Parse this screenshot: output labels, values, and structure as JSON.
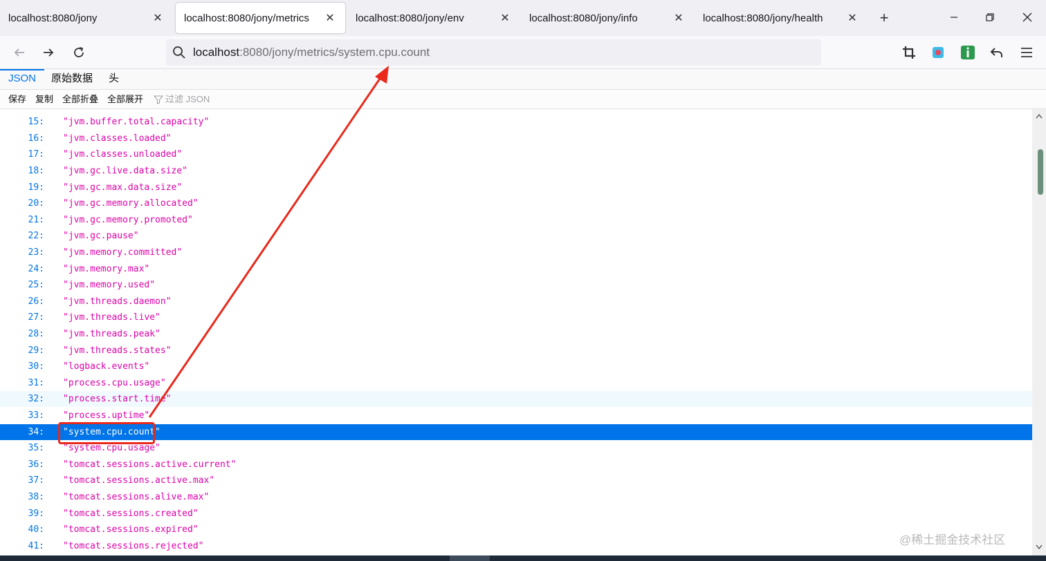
{
  "tabs": [
    {
      "title": "localhost:8080/jony",
      "active": false
    },
    {
      "title": "localhost:8080/jony/metrics",
      "active": true
    },
    {
      "title": "localhost:8080/jony/env",
      "active": false
    },
    {
      "title": "localhost:8080/jony/info",
      "active": false
    },
    {
      "title": "localhost:8080/jony/health",
      "active": false
    }
  ],
  "url": {
    "host": "localhost",
    "rest": ":8080/jony/metrics/system.cpu.count"
  },
  "viewer_tabs": [
    "JSON",
    "原始数据",
    "头"
  ],
  "toolbar": {
    "save": "保存",
    "copy": "复制",
    "collapse_all": "全部折叠",
    "expand_all": "全部展开",
    "filter_placeholder": "过滤 JSON"
  },
  "rows": [
    {
      "line": "15:",
      "value": "\"jvm.buffer.total.capacity\""
    },
    {
      "line": "16:",
      "value": "\"jvm.classes.loaded\""
    },
    {
      "line": "17:",
      "value": "\"jvm.classes.unloaded\""
    },
    {
      "line": "18:",
      "value": "\"jvm.gc.live.data.size\""
    },
    {
      "line": "19:",
      "value": "\"jvm.gc.max.data.size\""
    },
    {
      "line": "20:",
      "value": "\"jvm.gc.memory.allocated\""
    },
    {
      "line": "21:",
      "value": "\"jvm.gc.memory.promoted\""
    },
    {
      "line": "22:",
      "value": "\"jvm.gc.pause\""
    },
    {
      "line": "23:",
      "value": "\"jvm.memory.committed\""
    },
    {
      "line": "24:",
      "value": "\"jvm.memory.max\""
    },
    {
      "line": "25:",
      "value": "\"jvm.memory.used\""
    },
    {
      "line": "26:",
      "value": "\"jvm.threads.daemon\""
    },
    {
      "line": "27:",
      "value": "\"jvm.threads.live\""
    },
    {
      "line": "28:",
      "value": "\"jvm.threads.peak\""
    },
    {
      "line": "29:",
      "value": "\"jvm.threads.states\""
    },
    {
      "line": "30:",
      "value": "\"logback.events\""
    },
    {
      "line": "31:",
      "value": "\"process.cpu.usage\""
    },
    {
      "line": "32:",
      "value": "\"process.start.time\"",
      "state": "hover"
    },
    {
      "line": "33:",
      "value": "\"process.uptime\""
    },
    {
      "line": "34:",
      "value": "\"system.cpu.count\"",
      "state": "selected"
    },
    {
      "line": "35:",
      "value": "\"system.cpu.usage\""
    },
    {
      "line": "36:",
      "value": "\"tomcat.sessions.active.current\""
    },
    {
      "line": "37:",
      "value": "\"tomcat.sessions.active.max\""
    },
    {
      "line": "38:",
      "value": "\"tomcat.sessions.alive.max\""
    },
    {
      "line": "39:",
      "value": "\"tomcat.sessions.created\""
    },
    {
      "line": "40:",
      "value": "\"tomcat.sessions.expired\""
    },
    {
      "line": "41:",
      "value": "\"tomcat.sessions.rejected\""
    }
  ],
  "watermark": "@稀土掘金技术社区",
  "colors": {
    "accent": "#0074e8",
    "string": "#dd00a9",
    "annotation": "#e8291c"
  }
}
